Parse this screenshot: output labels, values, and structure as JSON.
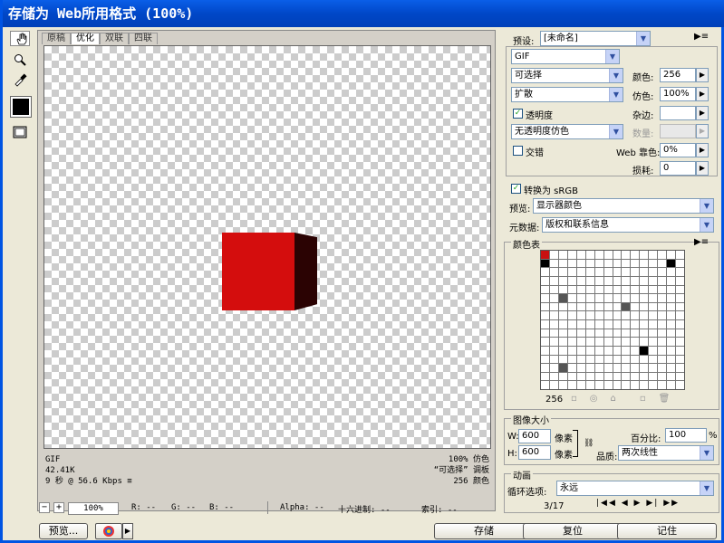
{
  "title": "存储为 Web所用格式 (100%)",
  "tools": [
    "hand-icon",
    "slice-select-icon",
    "zoom-icon",
    "eyedropper-icon",
    "color-swatch-icon",
    "toggle-slices-icon"
  ],
  "tabs": [
    "原稿",
    "优化",
    "双联",
    "四联"
  ],
  "active_tab": 1,
  "info": {
    "format": "GIF",
    "size": "42.41K",
    "time": "9 秒 @ 56.6 Kbps",
    "dither": "100% 仿色",
    "palette": "“可选择” 调板",
    "colors": "256 颜色"
  },
  "zoom": "100%",
  "readouts": {
    "r": "R: --",
    "g": "G: --",
    "b": "B: --",
    "alpha": "Alpha: --",
    "hex": "十六进制: --",
    "index": "索引: --"
  },
  "buttons": {
    "preview": "预览...",
    "save": "存储",
    "reset": "复位",
    "remember": "记住"
  },
  "settings": {
    "preset_label": "预设:",
    "preset_value": "[未命名]",
    "format": "GIF",
    "reduction": "可选择",
    "dither_algo": "扩散",
    "transparency_label": "透明度",
    "transparency_dither": "无透明度仿色",
    "interlaced_label": "交错",
    "colors_label": "颜色:",
    "colors_value": "256",
    "dither_label": "仿色:",
    "dither_value": "100%",
    "matte_label": "杂边:",
    "amount_label": "数量:",
    "web_snap_label": "Web 靠色:",
    "web_snap_value": "0%",
    "lossy_label": "损耗:",
    "lossy_value": "0",
    "convert_srgb": "转换为 sRGB",
    "preview_label": "预览:",
    "preview_value": "显示器颜色",
    "metadata_label": "元数据:",
    "metadata_value": "版权和联系信息"
  },
  "color_table": {
    "label": "颜色表",
    "count": "256"
  },
  "image_size": {
    "label": "图像大小",
    "w_label": "W:",
    "w_value": "600",
    "w_unit": "像素",
    "h_label": "H:",
    "h_value": "600",
    "h_unit": "像素",
    "percent_label": "百分比:",
    "percent_value": "100",
    "percent_unit": "%",
    "quality_label": "品质:",
    "quality_value": "两次线性"
  },
  "animation": {
    "label": "动画",
    "loop_label": "循环选项:",
    "loop_value": "永远",
    "frame": "3/17"
  },
  "colors": {
    "accent": "#0054e3",
    "cube_front": "#d40d0d",
    "cube_side": "#2b0303"
  }
}
